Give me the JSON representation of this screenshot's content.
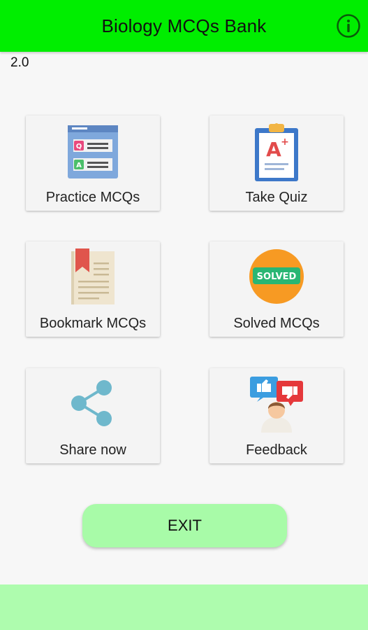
{
  "header": {
    "title": "Biology MCQs Bank",
    "info_icon": "info-icon"
  },
  "version": "2.0",
  "menu": [
    {
      "label": "Practice MCQs",
      "icon": "practice-mcqs-icon"
    },
    {
      "label": "Take Quiz",
      "icon": "clipboard-a-plus-icon"
    },
    {
      "label": "Bookmark MCQs",
      "icon": "bookmark-book-icon"
    },
    {
      "label": "Solved MCQs",
      "icon": "solved-badge-icon",
      "badge_text": "SOLVED"
    },
    {
      "label": "Share now",
      "icon": "share-icon"
    },
    {
      "label": "Feedback",
      "icon": "feedback-icon"
    }
  ],
  "practice_icon": {
    "q": "Q",
    "a": "A"
  },
  "quiz_icon": {
    "grade": "A",
    "plus": "+"
  },
  "exit_label": "EXIT",
  "colors": {
    "appbar": "#00ee00",
    "exit_button": "#a8fba8",
    "bottom_bar": "#aefcae"
  }
}
